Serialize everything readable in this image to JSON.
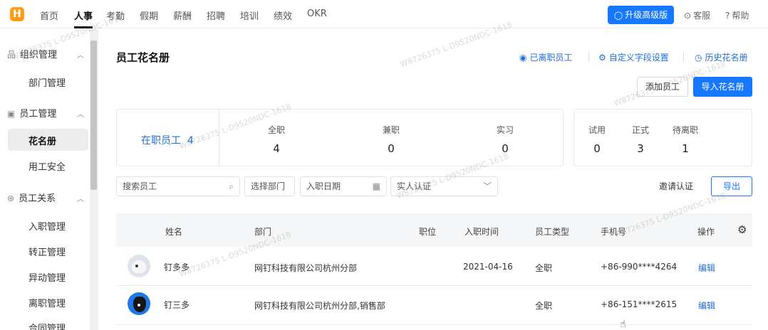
{
  "app": {
    "logo_text": "H"
  },
  "topnav": {
    "items": [
      "首页",
      "人事",
      "考勤",
      "假期",
      "薪酬",
      "招聘",
      "培训",
      "绩效",
      "OKR"
    ],
    "upgrade_label": "升级高级版",
    "service_label": "客服",
    "help_label": "帮助"
  },
  "sidebar": {
    "groups": [
      {
        "label": "组织管理",
        "items": [
          "部门管理"
        ]
      },
      {
        "label": "员工管理",
        "items": [
          "花名册",
          "用工安全"
        ]
      },
      {
        "label": "员工关系",
        "items": [
          "入职管理",
          "转正管理",
          "异动管理",
          "离职管理",
          "合同管理"
        ]
      }
    ]
  },
  "page": {
    "title": "员工花名册",
    "links": [
      "已离职员工",
      "自定义字段设置",
      "历史花名册"
    ],
    "add_employee_label": "添加员工",
    "import_label": "导入花名册"
  },
  "stats": {
    "active_label": "在职员工",
    "active_count": "4",
    "types": [
      {
        "label": "全职",
        "value": "4"
      },
      {
        "label": "兼职",
        "value": "0"
      },
      {
        "label": "实习",
        "value": "0"
      }
    ],
    "statuses": [
      {
        "label": "试用",
        "value": "0"
      },
      {
        "label": "正式",
        "value": "3"
      },
      {
        "label": "待离职",
        "value": "1"
      }
    ]
  },
  "filters": {
    "search_placeholder": "搜索员工",
    "department_label": "选择部门",
    "date_label": "入职日期",
    "verify_label": "实人认证",
    "invite_label": "邀请认证",
    "export_label": "导出"
  },
  "table": {
    "columns": [
      "姓名",
      "部门",
      "职位",
      "入职时间",
      "员工类型",
      "手机号",
      "操作"
    ],
    "rows": [
      {
        "name": "钉多多",
        "department": "网钉科技有限公司杭州分部",
        "position": "",
        "join_date": "2021-04-16",
        "type": "全职",
        "phone": "+86-990****4264",
        "action": "编辑"
      },
      {
        "name": "钉三多",
        "department": "网钉科技有限公司杭州分部,销售部",
        "position": "",
        "join_date": "",
        "type": "全职",
        "phone": "+86-151****2615",
        "action": "编辑"
      }
    ]
  },
  "watermark_text": "W8726375 L-D9520NDC-1618",
  "colors": {
    "primary": "#1677ff",
    "link": "#1f6fd9",
    "logo": "#ff9c1a"
  }
}
